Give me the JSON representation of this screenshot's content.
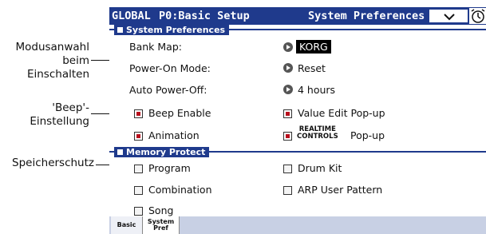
{
  "callouts": {
    "mode": "Modusanwahl beim Einschalten",
    "beep": "'Beep'- Einstellung",
    "memory": "Speicherschutz"
  },
  "header": {
    "mode": "GLOBAL",
    "page": "P0:Basic Setup",
    "tab_name": "System Preferences"
  },
  "system_preferences": {
    "title": "System Preferences",
    "bank_map_label": "Bank Map:",
    "bank_map_value": "KORG",
    "power_on_label": "Power-On Mode:",
    "power_on_value": "Reset",
    "auto_power_label": "Auto Power-Off:",
    "auto_power_value": "4 hours",
    "beep_enable": {
      "label": "Beep Enable",
      "checked": true
    },
    "animation": {
      "label": "Animation",
      "checked": true
    },
    "value_edit_popup": {
      "label": "Value Edit Pop-up",
      "checked": true
    },
    "realtime_controls": {
      "line1": "REALTIME",
      "line2": "CONTROLS",
      "label": "Pop-up",
      "checked": true
    }
  },
  "memory_protect": {
    "title": "Memory Protect",
    "program": {
      "label": "Program",
      "checked": false
    },
    "combination": {
      "label": "Combination",
      "checked": false
    },
    "song": {
      "label": "Song",
      "checked": false
    },
    "drum_kit": {
      "label": "Drum Kit",
      "checked": false
    },
    "arp_user_pattern": {
      "label": "ARP User Pattern",
      "checked": false
    }
  },
  "tabs": [
    {
      "label": "Basic",
      "active": false
    },
    {
      "label_line1": "System",
      "label_line2": "Pref",
      "active": true
    }
  ],
  "icons": {
    "menu": "chevron-down-icon",
    "clock": "clock-icon",
    "popup": "popup-arrow-icon"
  },
  "colors": {
    "title_bar": "#1f3a8c",
    "checkbox_on": "#b80f1d",
    "screen_bg": "#c8d0e4"
  }
}
